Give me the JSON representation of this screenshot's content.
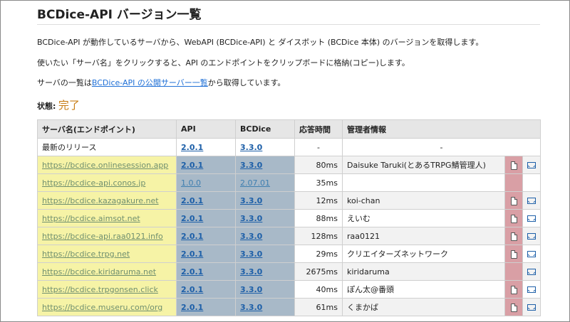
{
  "title": "BCDice-API バージョン一覧",
  "intro": {
    "line1": "BCDice-API が動作しているサーバから、WebAPI (BCDice-API) と ダイスボット (BCDice 本体) のバージョンを取得します。",
    "line2": "使いたい「サーバ名」をクリックすると、API のエンドポイントをクリップボードに格納(コピー)します。",
    "line3_pre": "サーバの一覧は",
    "line3_link": "BCDice-API の公開サーバー一覧",
    "line3_post": "から取得しています。"
  },
  "status": {
    "label": "状態:",
    "value": "完了"
  },
  "table": {
    "headers": {
      "server": "サーバ名(エンドポイント)",
      "api": "API",
      "bcdice": "BCDice",
      "resp": "応答時間",
      "admin": "管理者情報"
    },
    "latest": {
      "label": "最新のリリース",
      "api": "2.0.1",
      "bcdice": "3.3.0",
      "resp": "-",
      "admin": "-"
    },
    "rows": [
      {
        "server": "https://bcdice.onlinesession.app",
        "api": "2.0.1",
        "bcdice": "3.3.0",
        "resp": "80ms",
        "admin": "Daisuke Taruki(とあるTRPG鯖管理人)",
        "doc": true,
        "mail": true,
        "old": false
      },
      {
        "server": "https://bcdice-api.conos.jp",
        "api": "1.0.0",
        "bcdice": "2.07.01",
        "resp": "35ms",
        "admin": "",
        "doc": false,
        "mail": false,
        "old": true
      },
      {
        "server": "https://bcdice.kazagakure.net",
        "api": "2.0.1",
        "bcdice": "3.3.0",
        "resp": "12ms",
        "admin": "koi-chan",
        "doc": true,
        "mail": true,
        "old": false
      },
      {
        "server": "https://bcdice.aimsot.net",
        "api": "2.0.1",
        "bcdice": "3.3.0",
        "resp": "88ms",
        "admin": "えいむ",
        "doc": true,
        "mail": true,
        "old": false
      },
      {
        "server": "https://bcdice-api.raa0121.info",
        "api": "2.0.1",
        "bcdice": "3.3.0",
        "resp": "128ms",
        "admin": "raa0121",
        "doc": true,
        "mail": true,
        "old": false
      },
      {
        "server": "https://bcdice.trpg.net",
        "api": "2.0.1",
        "bcdice": "3.3.0",
        "resp": "29ms",
        "admin": "クリエイターズネットワーク",
        "doc": true,
        "mail": true,
        "old": false
      },
      {
        "server": "https://bcdice.kiridaruma.net",
        "api": "2.0.1",
        "bcdice": "3.3.0",
        "resp": "2675ms",
        "admin": "kiridaruma",
        "doc": false,
        "mail": true,
        "old": false
      },
      {
        "server": "https://bcdice.trpgonsen.click",
        "api": "2.0.1",
        "bcdice": "3.3.0",
        "resp": "40ms",
        "admin": "ぽん太@番頭",
        "doc": true,
        "mail": true,
        "old": false
      },
      {
        "server": "https://bcdice.museru.com/org",
        "api": "2.0.1",
        "bcdice": "3.3.0",
        "resp": "61ms",
        "admin": "くまかば",
        "doc": true,
        "mail": true,
        "old": false
      }
    ]
  },
  "colors": {
    "status": "#c77c14",
    "server_bg": "#f6f3a6",
    "version_bg": "#a8b9c8",
    "doc_bg": "#d99fa5",
    "link": "#1e6fd6"
  }
}
